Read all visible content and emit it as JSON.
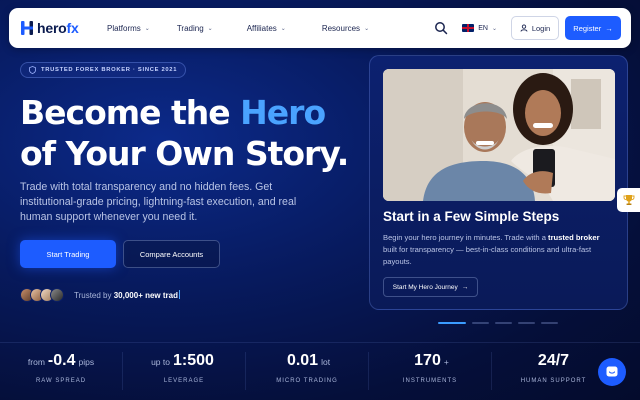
{
  "nav": {
    "logo_prefix": "hero",
    "logo_suffix": "fx",
    "links": [
      {
        "label": "Platforms"
      },
      {
        "label": "Trading"
      },
      {
        "label": "Affiliates"
      },
      {
        "label": "Resources"
      }
    ],
    "language": "EN",
    "login_label": "Login",
    "register_label": "Register"
  },
  "hero": {
    "badge": "TRUSTED FOREX BROKER · SINCE 2021",
    "headline_line1_a": "Become the ",
    "headline_line1_b": "Hero",
    "headline_line2": "of Your Own Story.",
    "subtitle": "Trade with total transparency and no hidden fees. Get institutional-grade pricing, lightning-fast execution, and real human support whenever you need it.",
    "primary_cta": "Start Trading",
    "secondary_cta": "Compare Accounts",
    "trusted_prefix": "Trusted by ",
    "trusted_count": "30,000+ new trad"
  },
  "card": {
    "title": "Start in a Few Simple Steps",
    "desc_a": "Begin your hero journey in minutes. Trade with a ",
    "desc_b": "trusted broker",
    "desc_c": " built for transparency — best-in-class conditions and ultra-fast payouts.",
    "button": "Start My Hero Journey"
  },
  "carousel": {
    "count": 5,
    "active": 0
  },
  "stats": [
    {
      "prefix": "from",
      "value": "-0.4",
      "suffix": "pips",
      "label": "RAW SPREAD"
    },
    {
      "prefix": "up to",
      "value": "1:500",
      "suffix": "",
      "label": "LEVERAGE"
    },
    {
      "prefix": "",
      "value": "0.01",
      "suffix": "lot",
      "label": "MICRO TRADING"
    },
    {
      "prefix": "",
      "value": "170",
      "suffix": "+",
      "label": "INSTRUMENTS"
    },
    {
      "prefix": "",
      "value": "24/7",
      "suffix": "",
      "label": "HUMAN SUPPORT"
    }
  ],
  "colors": {
    "accent": "#1d5cff",
    "highlight": "#4aa3ff",
    "background": "#071a5e"
  }
}
